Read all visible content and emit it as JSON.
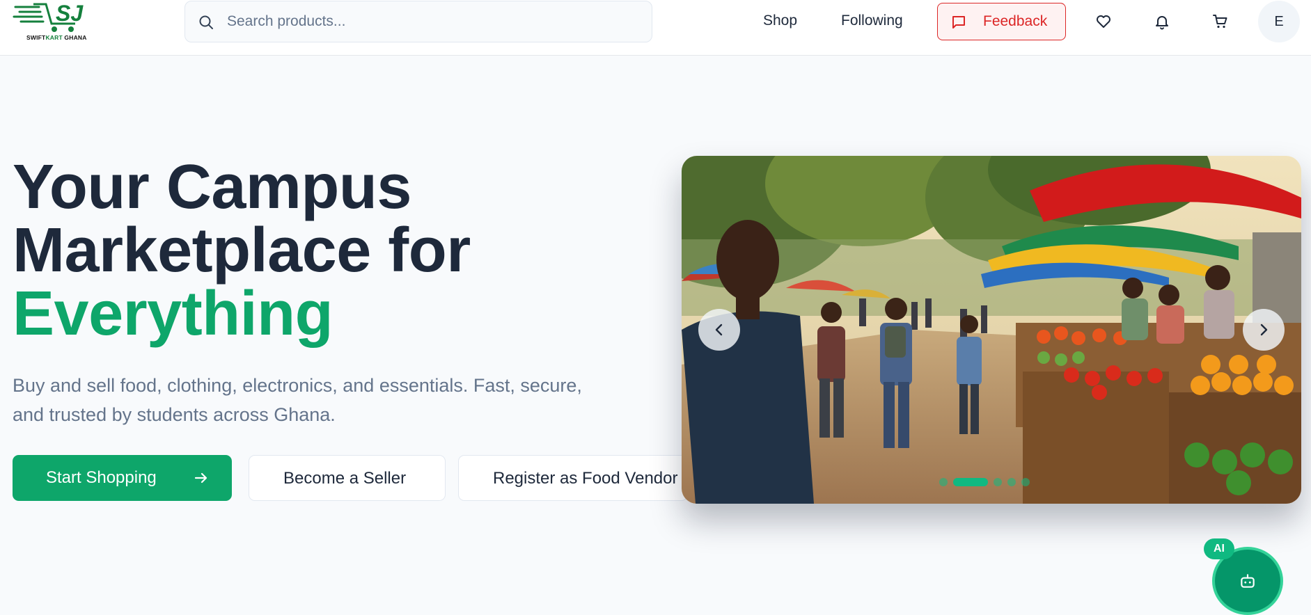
{
  "brand": {
    "logo_mark": "SJ",
    "name_part1": "SWIFT",
    "name_part2": "KART",
    "name_part3": " GHANA",
    "accent": "#0ea66a"
  },
  "header": {
    "search": {
      "placeholder": "Search products...",
      "value": "",
      "icon": "search-icon"
    },
    "nav": {
      "shop": "Shop",
      "following": "Following"
    },
    "feedback": {
      "label": "Feedback",
      "icon": "message-square-icon",
      "color": "#dc2626"
    },
    "icons": [
      "heart-icon",
      "bell-icon",
      "cart-icon"
    ],
    "avatar_initial": "E"
  },
  "hero": {
    "title_line1": "Your Campus",
    "title_line2": "Marketplace for",
    "title_accent": "Everything",
    "subtitle_line1": "Buy and sell food, clothing, electronics, and essentials. Fast, secure,",
    "subtitle_line2": "and trusted by students across Ghana.",
    "buttons": {
      "start_shopping": "Start Shopping",
      "become_seller": "Become a Seller",
      "register_vendor": "Register as Food Vendor"
    }
  },
  "carousel": {
    "slide_count": 5,
    "active_index": 1,
    "prev_icon": "chevron-left-icon",
    "next_icon": "chevron-right-icon"
  },
  "ai_assistant": {
    "badge": "AI",
    "icon": "bot-icon"
  }
}
